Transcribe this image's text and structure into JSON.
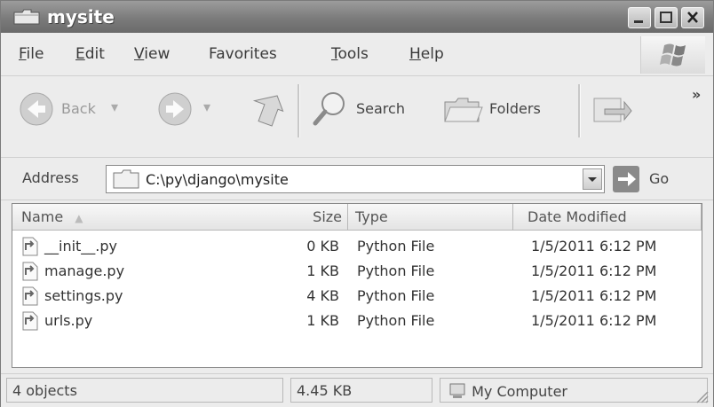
{
  "window": {
    "title": "mysite"
  },
  "menu": {
    "items": [
      {
        "key": "F",
        "rest": "ile"
      },
      {
        "key": "E",
        "rest": "dit"
      },
      {
        "key": "V",
        "rest": "iew"
      },
      {
        "key": "Fa",
        "rest": "vorites",
        "full": "Favorites"
      },
      {
        "key": "T",
        "rest": "ools"
      },
      {
        "key": "H",
        "rest": "elp"
      }
    ]
  },
  "toolbar": {
    "back_label": "Back",
    "search_label": "Search",
    "folders_label": "Folders",
    "more_label": "»"
  },
  "address": {
    "label": "Address",
    "value": "C:\\py\\django\\mysite",
    "go_label": "Go"
  },
  "list": {
    "columns": [
      "Name",
      "Size",
      "Type",
      "Date Modified"
    ],
    "rows": [
      {
        "name": "__init__.py",
        "size": "0 KB",
        "type": "Python File",
        "date": "1/5/2011 6:12 PM"
      },
      {
        "name": "manage.py",
        "size": "1 KB",
        "type": "Python File",
        "date": "1/5/2011 6:12 PM"
      },
      {
        "name": "settings.py",
        "size": "4 KB",
        "type": "Python File",
        "date": "1/5/2011 6:12 PM"
      },
      {
        "name": "urls.py",
        "size": "1 KB",
        "type": "Python File",
        "date": "1/5/2011 6:12 PM"
      }
    ]
  },
  "status": {
    "objects": "4 objects",
    "size": "4.45 KB",
    "location": "My Computer"
  }
}
